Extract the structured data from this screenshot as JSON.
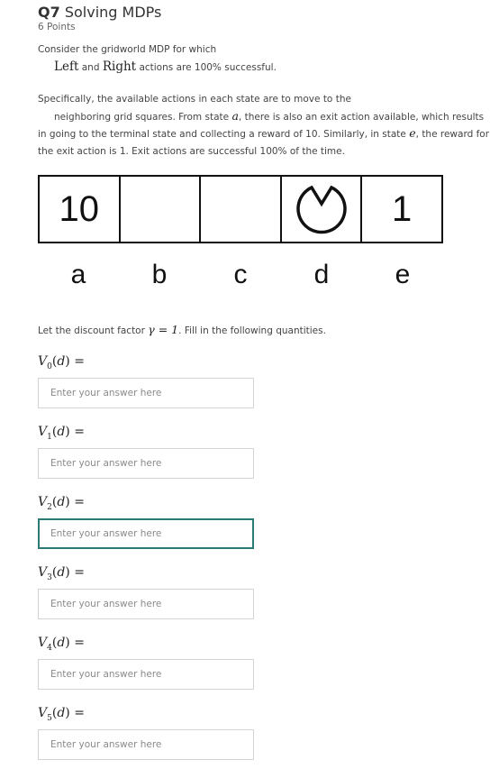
{
  "question": {
    "number": "Q7",
    "title": "Solving MDPs",
    "points": "6 Points"
  },
  "intro": {
    "line1": "Consider the gridworld MDP for which",
    "left": "Left",
    "and": "and",
    "right": "Right",
    "rest": "actions are 100% successful."
  },
  "description": {
    "line1": "Specifically, the available actions in each state are to move to the",
    "line2_a": "neighboring grid squares.  From state",
    "state_a": "a",
    "line2_b": ", there is also an exit action available, which results",
    "line3_a": "in going to the terminal state and collecting a reward of 10. Similarly, in state",
    "state_e": "e",
    "line3_b": ", the reward for",
    "line4": "the exit action is 1. Exit actions are successful 100% of the time."
  },
  "grid": {
    "cells": [
      "10",
      "",
      "",
      "",
      "1"
    ],
    "agent_cell": "d",
    "agent_icon": "pacman-icon",
    "state_labels": [
      "a",
      "b",
      "c",
      "d",
      "e"
    ]
  },
  "discount": {
    "prefix": "Let the discount factor",
    "gamma": "γ = 1",
    "suffix": ". Fill in the following quantities."
  },
  "quantities": [
    {
      "v": "V",
      "sub": "0",
      "arg": "d",
      "placeholder": "Enter your answer here",
      "value": "",
      "focused": false
    },
    {
      "v": "V",
      "sub": "1",
      "arg": "d",
      "placeholder": "Enter your answer here",
      "value": "",
      "focused": false
    },
    {
      "v": "V",
      "sub": "2",
      "arg": "d",
      "placeholder": "Enter your answer here",
      "value": "",
      "focused": true
    },
    {
      "v": "V",
      "sub": "3",
      "arg": "d",
      "placeholder": "Enter your answer here",
      "value": "",
      "focused": false
    },
    {
      "v": "V",
      "sub": "4",
      "arg": "d",
      "placeholder": "Enter your answer here",
      "value": "",
      "focused": false
    },
    {
      "v": "V",
      "sub": "5",
      "arg": "d",
      "placeholder": "Enter your answer here",
      "value": "",
      "focused": false
    }
  ],
  "colors": {
    "focus_border": "#2a7a73",
    "input_border": "#d4d4d4"
  }
}
